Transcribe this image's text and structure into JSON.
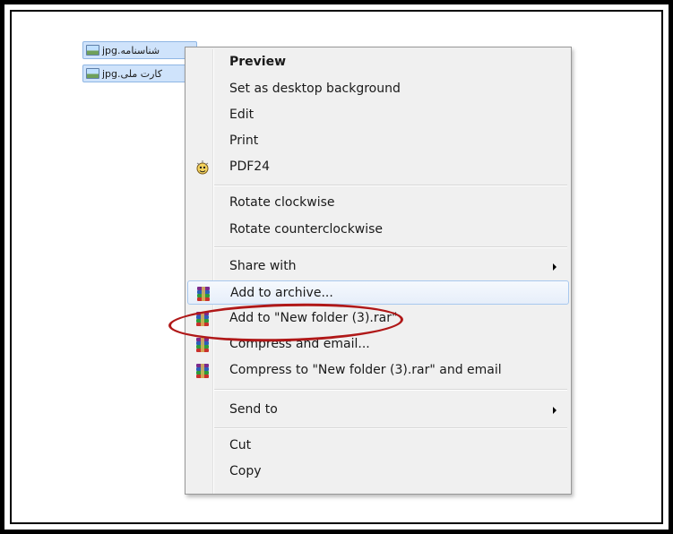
{
  "desktop": {
    "files": [
      {
        "name": "شناسنامه.jpg"
      },
      {
        "name": "کارت ملی.jpg"
      }
    ]
  },
  "context_menu": {
    "items": [
      {
        "label": "Preview",
        "bold": true
      },
      {
        "label": "Set as desktop background"
      },
      {
        "label": "Edit"
      },
      {
        "label": "Print"
      },
      {
        "label": "PDF24",
        "icon": "pdf24-icon"
      },
      {
        "label": "Rotate clockwise"
      },
      {
        "label": "Rotate counterclockwise"
      },
      {
        "label": "Share with",
        "submenu": true
      },
      {
        "label": "Add to archive...",
        "icon": "winrar-icon",
        "hovered": true
      },
      {
        "label": "Add to \"New folder (3).rar\"",
        "icon": "winrar-icon",
        "annotated": true
      },
      {
        "label": "Compress and email...",
        "icon": "winrar-icon"
      },
      {
        "label": "Compress to \"New folder (3).rar\" and email",
        "icon": "winrar-icon"
      },
      {
        "label": "Send to",
        "submenu": true
      },
      {
        "label": "Cut"
      },
      {
        "label": "Copy"
      }
    ]
  },
  "colors": {
    "annotation": "#b01818",
    "menu_background": "#f0f0f0",
    "selection": "#cfe3fb"
  }
}
